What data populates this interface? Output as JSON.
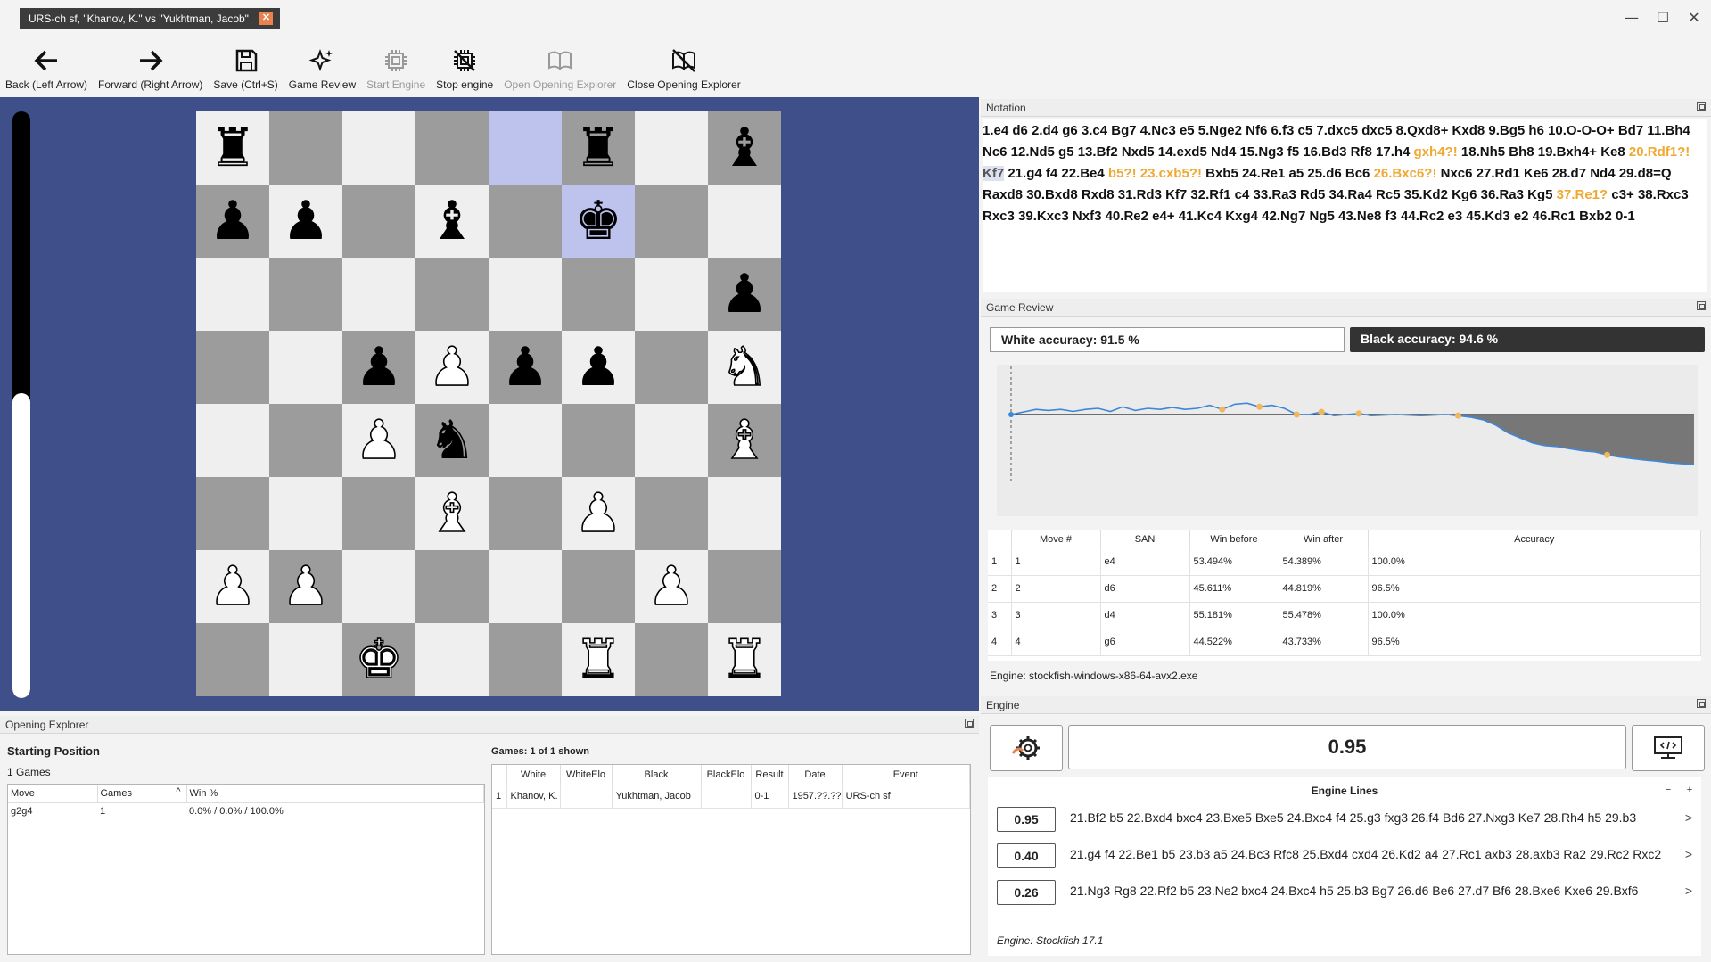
{
  "window": {
    "tab_title": "URS-ch sf,  \"Khanov, K.\" vs \"Yukhtman, Jacob\"",
    "tab_close": "✕",
    "minimize": "—",
    "maximize": "☐",
    "close": "✕"
  },
  "toolbar": {
    "back": "Back (Left Arrow)",
    "forward": "Forward (Right Arrow)",
    "save": "Save (Ctrl+S)",
    "game_review": "Game Review",
    "start_engine": "Start Engine",
    "stop_engine": "Stop engine",
    "open_explorer": "Open Opening Explorer",
    "close_explorer": "Close Opening Explorer"
  },
  "eval_bar": {
    "white_fraction": 0.52
  },
  "board": {
    "rows": [
      [
        "r",
        "",
        "",
        "",
        "",
        "r",
        "",
        "b"
      ],
      [
        "p",
        "p",
        "",
        "b",
        "",
        "k",
        "",
        ""
      ],
      [
        "",
        "",
        "",
        "",
        "",
        "",
        "",
        "p"
      ],
      [
        "",
        "",
        "p",
        "P",
        "p",
        "p",
        "",
        "N"
      ],
      [
        "",
        "",
        "P",
        "n",
        "",
        "",
        "",
        "B"
      ],
      [
        "",
        "",
        "",
        "B",
        "",
        "P",
        "",
        ""
      ],
      [
        "P",
        "P",
        "",
        "",
        "",
        "",
        "P",
        ""
      ],
      [
        "",
        "",
        "K",
        "",
        "",
        "R",
        "",
        "R"
      ]
    ],
    "highlight": [
      "e8",
      "f7"
    ]
  },
  "notation": {
    "header": "Notation",
    "moves": [
      {
        "t": "1.e4 d6 2.d4 g6 3.c4 Bg7 4.Nc3 e5 5.Nge2 Nf6 6.f3 c5 7.dxc5 dxc5 8.Qxd8+ Kxd8 9.Bg5 h6 10.O-O-O+ Bd7 11.Bh4 Nc6 12.Nd5 g5 13.Bf2 Nxd5 14.exd5 Nd4 15.Ng3 f5 16.Bd3 Rf8 17.h4 ",
        "s": ""
      },
      {
        "t": "gxh4?!",
        "s": "ann"
      },
      {
        "t": " 18.Nh5 Bh8 19.Bxh4+ Ke8 ",
        "s": ""
      },
      {
        "t": "20.Rdf1?!",
        "s": "ann"
      },
      {
        "t": " ",
        "s": ""
      },
      {
        "t": "Kf7",
        "s": "cur"
      },
      {
        "t": " 21.g4 f4 22.Be4 ",
        "s": ""
      },
      {
        "t": "b5?!",
        "s": "ann"
      },
      {
        "t": " ",
        "s": ""
      },
      {
        "t": "23.cxb5?!",
        "s": "ann"
      },
      {
        "t": " Bxb5 24.Re1 a5 25.d6 Bc6 ",
        "s": ""
      },
      {
        "t": "26.Bxc6?!",
        "s": "ann"
      },
      {
        "t": " Nxc6 27.Rd1 Ke6 28.d7 Nd4 29.d8=Q Raxd8 30.Bxd8 Rxd8 31.Rd3 Kf7 32.Rf1 c4 33.Ra3 Rd5 34.Ra4 Rc5 35.Kd2 Kg6 36.Ra3 Kg5 ",
        "s": ""
      },
      {
        "t": "37.Re1?",
        "s": "ann"
      },
      {
        "t": " c3+ 38.Rxc3 Rxc3 39.Kxc3 Nxf3 40.Re2 e4+ 41.Kc4 Kxg4 42.Ng7 Ng5 43.Ne8 f3 44.Rc2 e3 45.Kd3 e2 46.Rc1 Bxb2 0-1",
        "s": ""
      }
    ]
  },
  "game_review": {
    "header": "Game Review",
    "white_accuracy": "White accuracy: 91.5 %",
    "black_accuracy": "Black accuracy: 94.6 %",
    "eval_curve": [
      0.0,
      0.05,
      0.1,
      0.08,
      0.1,
      0.06,
      0.1,
      0.12,
      0.06,
      0.15,
      0.08,
      0.12,
      0.1,
      0.14,
      0.1,
      0.12,
      0.18,
      0.1,
      0.2,
      0.22,
      0.15,
      0.18,
      0.12,
      0.0,
      0.0,
      0.05,
      -0.02,
      0.0,
      0.02,
      -0.02,
      -0.01,
      0.0,
      -0.01,
      -0.02,
      -0.01,
      0.0,
      -0.02,
      -0.05,
      -0.1,
      -0.2,
      -0.35,
      -0.45,
      -0.55,
      -0.6,
      -0.62,
      -0.66,
      -0.7,
      -0.72,
      -0.78,
      -0.82,
      -0.85,
      -0.88,
      -0.9,
      -0.93,
      -0.95,
      -0.96
    ],
    "annotated_indices": [
      0,
      17,
      20,
      23,
      25,
      28,
      36,
      48
    ],
    "columns": [
      "Move #",
      "SAN",
      "Win before",
      "Win after",
      "Accuracy"
    ],
    "rows": [
      {
        "idx": "1",
        "move": "1",
        "san": "e4",
        "before": "53.494%",
        "after": "54.389%",
        "acc": "100.0%"
      },
      {
        "idx": "2",
        "move": "2",
        "san": "d6",
        "before": "45.611%",
        "after": "44.819%",
        "acc": "96.5%"
      },
      {
        "idx": "3",
        "move": "3",
        "san": "d4",
        "before": "55.181%",
        "after": "55.478%",
        "acc": "100.0%"
      },
      {
        "idx": "4",
        "move": "4",
        "san": "g6",
        "before": "44.522%",
        "after": "43.733%",
        "acc": "96.5%"
      }
    ],
    "engine_path": "Engine: stockfish-windows-x86-64-avx2.exe"
  },
  "engine": {
    "header": "Engine",
    "evaluation": "0.95",
    "lines_title": "Engine Lines",
    "minus": "−",
    "plus": "+",
    "lines": [
      {
        "score": "0.95",
        "pv": "21.Bf2 b5 22.Bxd4 bxc4 23.Bxe5 Bxe5 24.Bxc4 f4 25.g3 fxg3 26.f4 Bd6 27.Nxg3 Ke7 28.Rh4 h5 29.b3"
      },
      {
        "score": "0.40",
        "pv": "21.g4 f4 22.Be1 b5 23.b3 a5 24.Bc3 Rfc8 25.Bxd4 cxd4 26.Kd2 a4 27.Rc1 axb3 28.axb3 Ra2 29.Rc2 Rxc2"
      },
      {
        "score": "0.26",
        "pv": "21.Ng3 Rg8 22.Rf2 b5 23.Ne2 bxc4 24.Bxc4 h5 25.b3 Bg7 26.d6 Be6 27.d7 Bf6 28.Bxe6 Kxe6 29.Bxf6"
      }
    ],
    "arrow": ">",
    "engine_name": "Engine: Stockfish 17.1"
  },
  "explorer": {
    "header": "Opening Explorer",
    "title": "Starting Position",
    "games_count": "1 Games",
    "move_columns": [
      "Move",
      "Games",
      "Win %"
    ],
    "sort_icon": "^",
    "moves": [
      {
        "move": "g2g4",
        "games": "1",
        "win": "0.0% / 0.0% / 100.0%"
      }
    ],
    "games_label": "Games: 1 of 1 shown",
    "game_columns": [
      "White",
      "WhiteElo",
      "Black",
      "BlackElo",
      "Result",
      "Date",
      "Event"
    ],
    "games": [
      {
        "idx": "1",
        "white": "Khanov, K.",
        "welo": "",
        "black": "Yukhtman, Jacob",
        "belo": "",
        "result": "0-1",
        "date": "1957.??.??",
        "event": "URS-ch sf"
      }
    ]
  },
  "colors": {
    "board_bg": "#3f4f8a",
    "light_square": "#efefef",
    "dark_square": "#9c9c9c",
    "highlight": "#bec3ee",
    "annotation": "#f0a830",
    "chart_line": "#3f86d6",
    "chart_marker": "#f0b85a"
  }
}
